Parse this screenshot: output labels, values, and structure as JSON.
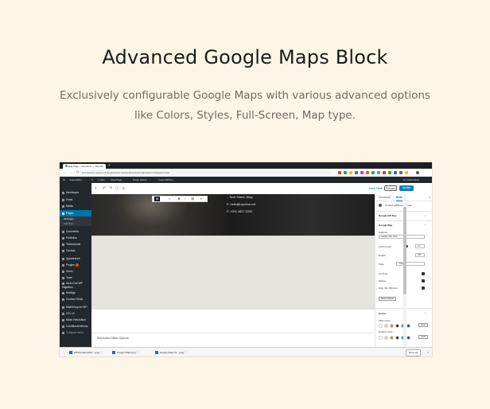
{
  "heading": "Advanced Google Maps Block",
  "subtitle_line1": "Exclusively configurable Google Maps with various advanced options",
  "subtitle_line2": "like Colors, Styles, Full-Screen, Map type.",
  "browser": {
    "tab_title": "Edit Page ‹ Gwenanis — WordPr",
    "new_tab": "+",
    "nav": "← → ⟳",
    "url": "Not secure | uxprimo.themekinstruct.net/wp-admin/post.php?post=176&action=edit"
  },
  "admin_bar": {
    "items": [
      "W",
      "Gwendoline",
      "0",
      "+ New",
      "View Page",
      "Purge Cache",
      "Insert WPRec"
    ],
    "user": "Hi, Gwendoline"
  },
  "sidebar": {
    "items": [
      "Dashboard",
      "Posts",
      "Media",
      "Pages",
      "Comments",
      "Portfolios",
      "Testimonials",
      "Contact",
      "Appearance",
      "Plugins",
      "Users",
      "Tools",
      "All-in-One WP Migration",
      "Settings",
      "Custom Fields",
      "MailChimp for WP",
      "GTL UI",
      "Slider Revolution",
      "Conditional Menus",
      "Collapse menu"
    ],
    "sub_items": [
      "All Pages",
      "Add New"
    ],
    "plugins_badge": "1"
  },
  "editor_toolbar": {
    "icons": [
      "+",
      "↶",
      "↷",
      "ⓘ",
      "≡"
    ],
    "save_draft": "Save Draft",
    "preview": "Preview",
    "update": "Update",
    "gear": "⚙",
    "more": "⋮"
  },
  "inline_toolbar": {
    "style": "▤",
    "align": "≡",
    "bold": "B",
    "italic": "I",
    "link": "⛓",
    "more": "▾"
  },
  "hero": {
    "line1": "...Tech Street, Bilsp",
    "line2": "E. hello@uxprimo.net",
    "line3": "P. +001 4827 2299"
  },
  "meta_box": {
    "label": "Revolution Slider Options",
    "chevron": "▲"
  },
  "panel": {
    "tab_document": "Document",
    "tab_block": "Block",
    "close": "×",
    "block_name": "Contact gWSGoogle map",
    "section_api": "Google API Key",
    "section_map": "Google Map",
    "address_label": "Address",
    "address_value": "Seattle, WA, USA",
    "zoom_label": "Zoom Level",
    "zoom_value": "12",
    "height_label": "Height",
    "height_value": "400",
    "style_label": "Style",
    "style_value": "Custom",
    "controls_label": "Controls",
    "marker_label": "Marker",
    "sig_label": "Hide Info Window",
    "reset_button": "Reset Default",
    "colors_section": "Colors",
    "fill_label": "Filter Color",
    "fill_clear": "Clear",
    "outline_label": "Outline Color",
    "outline_clear": "Clear",
    "chev_up": "^",
    "chev_down": "v"
  },
  "downloads": {
    "items": [
      "WPRU-RECORD....jpeg",
      "Google Maps.png",
      "Google Maps Al....jpeg"
    ],
    "show_all": "Show all",
    "close": "×"
  },
  "colors": {
    "accent": "#0073aa",
    "page_bg": "#fdf6e6",
    "swatches": [
      "#ffffff",
      "#e3d2b0",
      "#b58e5a",
      "#2b2b2b",
      "#1a8ae6",
      "#0d4a8e"
    ]
  }
}
